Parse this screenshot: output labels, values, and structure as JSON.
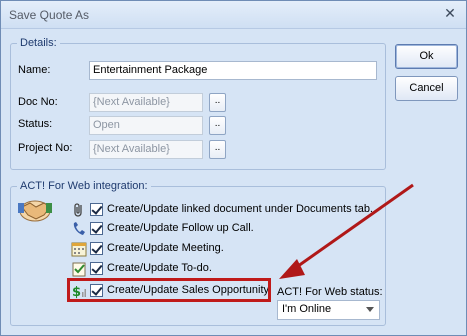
{
  "window": {
    "title": "Save Quote As",
    "close_glyph": "✕"
  },
  "details": {
    "legend": "Details:",
    "name_label": "Name:",
    "name_value": "Entertainment Package",
    "docno_label": "Doc No:",
    "docno_value": "{Next Available}",
    "status_label": "Status:",
    "status_value": "Open",
    "projectno_label": "Project No:",
    "projectno_value": "{Next Available}",
    "browse_label": ".."
  },
  "buttons": {
    "ok": "Ok",
    "cancel": "Cancel"
  },
  "integration": {
    "legend": "ACT! For Web integration:",
    "options": [
      {
        "label": "Create/Update linked document under Documents tab.",
        "icon": "paperclip-icon",
        "checked": true
      },
      {
        "label": "Create/Update Follow up Call.",
        "icon": "phone-icon",
        "checked": true
      },
      {
        "label": "Create/Update Meeting.",
        "icon": "calendar-icon",
        "checked": true
      },
      {
        "label": "Create/Update To-do.",
        "icon": "todo-icon",
        "checked": true
      },
      {
        "label": "Create/Update Sales Opportunity.",
        "icon": "dollar-icon",
        "checked": true
      }
    ],
    "status_label": "ACT! For Web status:",
    "status_value": "I'm Online"
  },
  "colors": {
    "highlight": "#c01a1a",
    "arrow": "#b01818",
    "window_bg": "#d6e4f5"
  }
}
